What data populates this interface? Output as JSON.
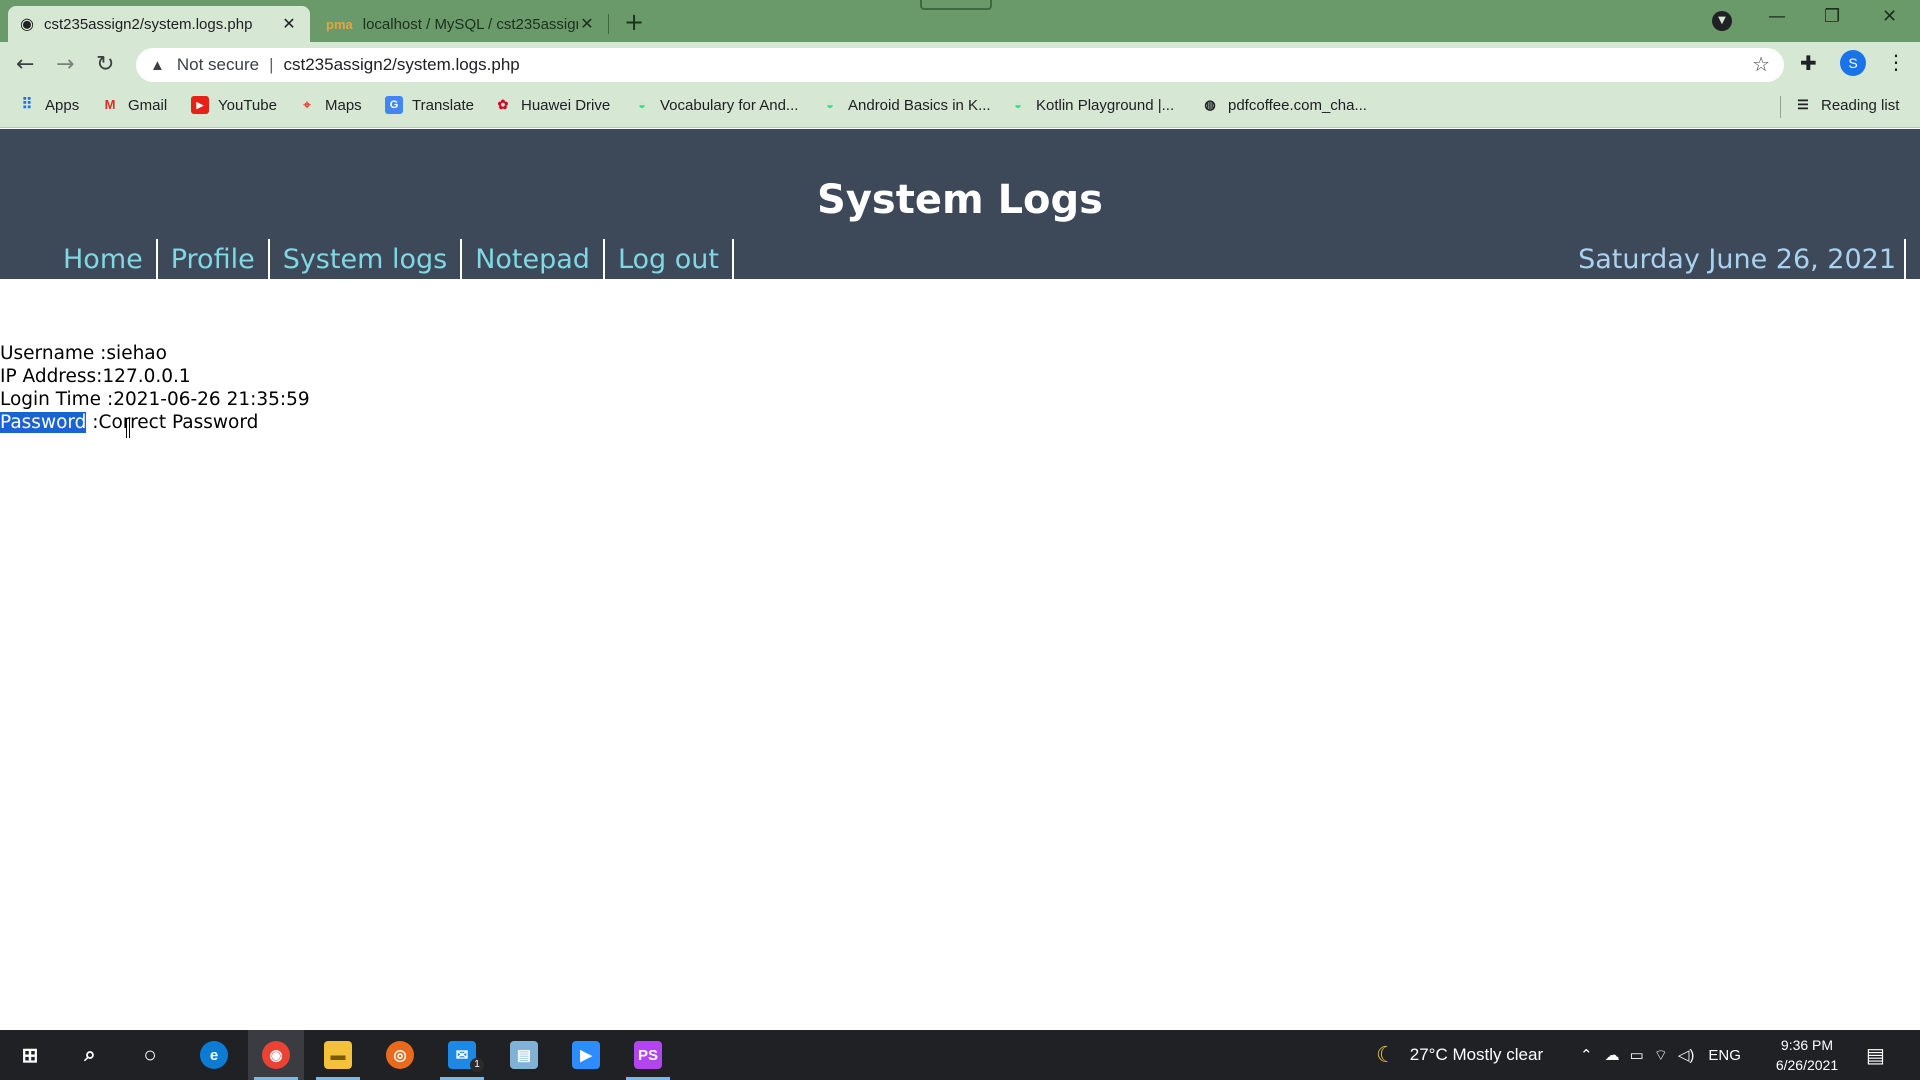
{
  "browser": {
    "tabs": [
      {
        "title": "cst235assign2/system.logs.php",
        "active": true
      },
      {
        "title": "localhost / MySQL / cst235assign",
        "active": false
      }
    ],
    "omnibox": {
      "security": "Not secure",
      "url": "cst235assign2/system.logs.php"
    },
    "profile_initial": "S",
    "bookmarks": [
      {
        "label": "Apps",
        "icon": "apps-grid-icon"
      },
      {
        "label": "Gmail",
        "icon": "gmail-icon"
      },
      {
        "label": "YouTube",
        "icon": "youtube-icon"
      },
      {
        "label": "Maps",
        "icon": "maps-icon"
      },
      {
        "label": "Translate",
        "icon": "translate-icon"
      },
      {
        "label": "Huawei Drive",
        "icon": "huawei-icon"
      },
      {
        "label": "Vocabulary for And...",
        "icon": "android-icon"
      },
      {
        "label": "Android Basics in K...",
        "icon": "android-icon"
      },
      {
        "label": "Kotlin Playground |...",
        "icon": "android-icon"
      },
      {
        "label": "pdfcoffee.com_cha...",
        "icon": "globe-icon"
      }
    ],
    "reading_list": "Reading list"
  },
  "page": {
    "title": "System Logs",
    "nav": [
      "Home",
      "Profile",
      "System logs",
      "Notepad",
      "Log out"
    ],
    "date": "Saturday June 26, 2021",
    "log": {
      "username_label": "Username :",
      "username": "siehao",
      "ip_label": "IP Address:",
      "ip": "127.0.0.1",
      "login_label": "Login Time :",
      "login_time": "2021-06-26 21:35:59",
      "password_label": "Password",
      "password_sep": " :",
      "password_value": "Correct Password"
    }
  },
  "taskbar": {
    "weather": "27°C  Mostly clear",
    "language": "ENG",
    "time": "9:36 PM",
    "date": "6/26/2021",
    "mail_badge": "1"
  },
  "colors": {
    "tab_strip": "#6a9a6a",
    "header_bg": "#3d4858",
    "nav_link": "#7fd8e4",
    "selection": "#1a63d6"
  }
}
